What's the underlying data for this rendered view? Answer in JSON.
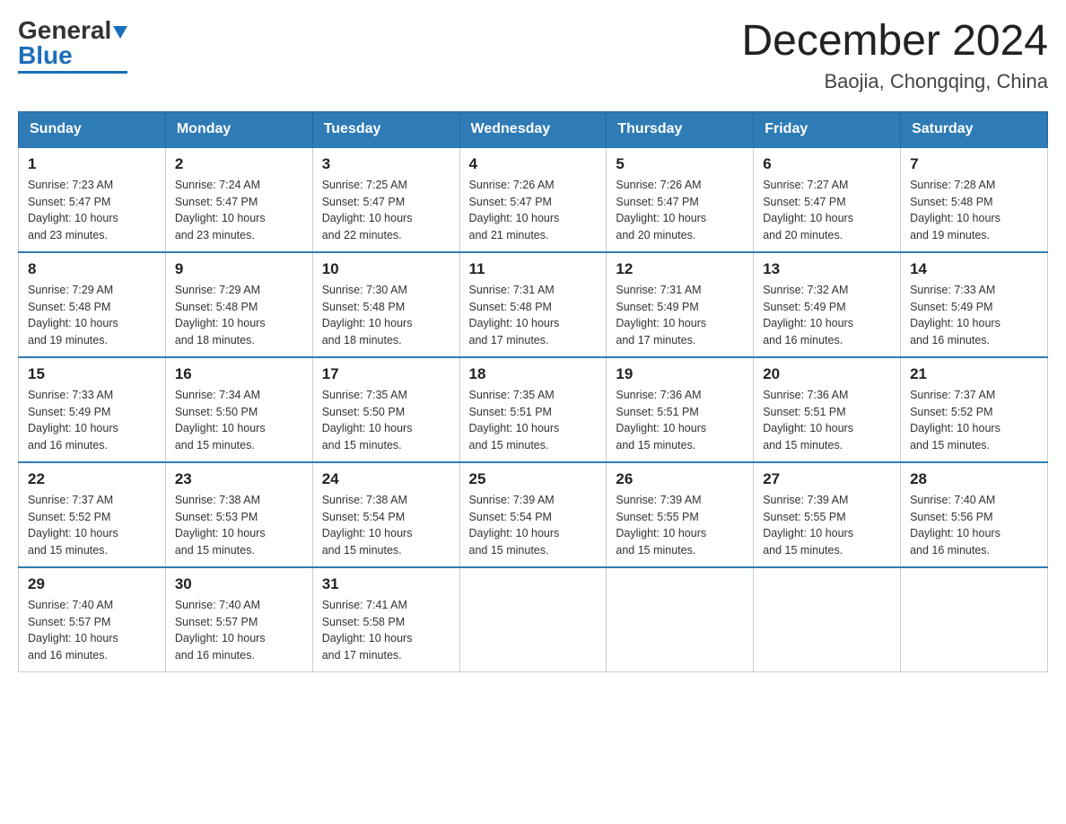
{
  "header": {
    "logo_general": "General",
    "logo_blue": "Blue",
    "title": "December 2024",
    "subtitle": "Baojia, Chongqing, China"
  },
  "days_of_week": [
    "Sunday",
    "Monday",
    "Tuesday",
    "Wednesday",
    "Thursday",
    "Friday",
    "Saturday"
  ],
  "weeks": [
    [
      {
        "day": "1",
        "sunrise": "7:23 AM",
        "sunset": "5:47 PM",
        "daylight": "10 hours and 23 minutes."
      },
      {
        "day": "2",
        "sunrise": "7:24 AM",
        "sunset": "5:47 PM",
        "daylight": "10 hours and 23 minutes."
      },
      {
        "day": "3",
        "sunrise": "7:25 AM",
        "sunset": "5:47 PM",
        "daylight": "10 hours and 22 minutes."
      },
      {
        "day": "4",
        "sunrise": "7:26 AM",
        "sunset": "5:47 PM",
        "daylight": "10 hours and 21 minutes."
      },
      {
        "day": "5",
        "sunrise": "7:26 AM",
        "sunset": "5:47 PM",
        "daylight": "10 hours and 20 minutes."
      },
      {
        "day": "6",
        "sunrise": "7:27 AM",
        "sunset": "5:47 PM",
        "daylight": "10 hours and 20 minutes."
      },
      {
        "day": "7",
        "sunrise": "7:28 AM",
        "sunset": "5:48 PM",
        "daylight": "10 hours and 19 minutes."
      }
    ],
    [
      {
        "day": "8",
        "sunrise": "7:29 AM",
        "sunset": "5:48 PM",
        "daylight": "10 hours and 19 minutes."
      },
      {
        "day": "9",
        "sunrise": "7:29 AM",
        "sunset": "5:48 PM",
        "daylight": "10 hours and 18 minutes."
      },
      {
        "day": "10",
        "sunrise": "7:30 AM",
        "sunset": "5:48 PM",
        "daylight": "10 hours and 18 minutes."
      },
      {
        "day": "11",
        "sunrise": "7:31 AM",
        "sunset": "5:48 PM",
        "daylight": "10 hours and 17 minutes."
      },
      {
        "day": "12",
        "sunrise": "7:31 AM",
        "sunset": "5:49 PM",
        "daylight": "10 hours and 17 minutes."
      },
      {
        "day": "13",
        "sunrise": "7:32 AM",
        "sunset": "5:49 PM",
        "daylight": "10 hours and 16 minutes."
      },
      {
        "day": "14",
        "sunrise": "7:33 AM",
        "sunset": "5:49 PM",
        "daylight": "10 hours and 16 minutes."
      }
    ],
    [
      {
        "day": "15",
        "sunrise": "7:33 AM",
        "sunset": "5:49 PM",
        "daylight": "10 hours and 16 minutes."
      },
      {
        "day": "16",
        "sunrise": "7:34 AM",
        "sunset": "5:50 PM",
        "daylight": "10 hours and 15 minutes."
      },
      {
        "day": "17",
        "sunrise": "7:35 AM",
        "sunset": "5:50 PM",
        "daylight": "10 hours and 15 minutes."
      },
      {
        "day": "18",
        "sunrise": "7:35 AM",
        "sunset": "5:51 PM",
        "daylight": "10 hours and 15 minutes."
      },
      {
        "day": "19",
        "sunrise": "7:36 AM",
        "sunset": "5:51 PM",
        "daylight": "10 hours and 15 minutes."
      },
      {
        "day": "20",
        "sunrise": "7:36 AM",
        "sunset": "5:51 PM",
        "daylight": "10 hours and 15 minutes."
      },
      {
        "day": "21",
        "sunrise": "7:37 AM",
        "sunset": "5:52 PM",
        "daylight": "10 hours and 15 minutes."
      }
    ],
    [
      {
        "day": "22",
        "sunrise": "7:37 AM",
        "sunset": "5:52 PM",
        "daylight": "10 hours and 15 minutes."
      },
      {
        "day": "23",
        "sunrise": "7:38 AM",
        "sunset": "5:53 PM",
        "daylight": "10 hours and 15 minutes."
      },
      {
        "day": "24",
        "sunrise": "7:38 AM",
        "sunset": "5:54 PM",
        "daylight": "10 hours and 15 minutes."
      },
      {
        "day": "25",
        "sunrise": "7:39 AM",
        "sunset": "5:54 PM",
        "daylight": "10 hours and 15 minutes."
      },
      {
        "day": "26",
        "sunrise": "7:39 AM",
        "sunset": "5:55 PM",
        "daylight": "10 hours and 15 minutes."
      },
      {
        "day": "27",
        "sunrise": "7:39 AM",
        "sunset": "5:55 PM",
        "daylight": "10 hours and 15 minutes."
      },
      {
        "day": "28",
        "sunrise": "7:40 AM",
        "sunset": "5:56 PM",
        "daylight": "10 hours and 16 minutes."
      }
    ],
    [
      {
        "day": "29",
        "sunrise": "7:40 AM",
        "sunset": "5:57 PM",
        "daylight": "10 hours and 16 minutes."
      },
      {
        "day": "30",
        "sunrise": "7:40 AM",
        "sunset": "5:57 PM",
        "daylight": "10 hours and 16 minutes."
      },
      {
        "day": "31",
        "sunrise": "7:41 AM",
        "sunset": "5:58 PM",
        "daylight": "10 hours and 17 minutes."
      },
      null,
      null,
      null,
      null
    ]
  ],
  "labels": {
    "sunrise": "Sunrise:",
    "sunset": "Sunset:",
    "daylight": "Daylight:"
  }
}
